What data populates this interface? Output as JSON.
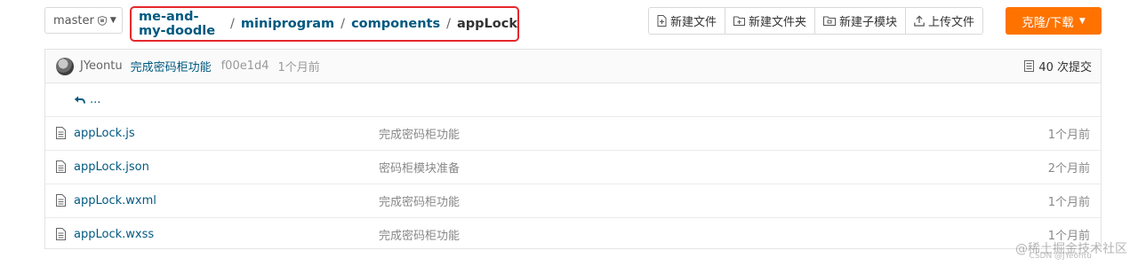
{
  "branch": {
    "name": "master"
  },
  "breadcrumb": {
    "items": [
      "me-and-my-doodle",
      "miniprogram",
      "components"
    ],
    "current": "appLock",
    "separator": "/"
  },
  "toolbar": {
    "new_file": "新建文件",
    "new_folder": "新建文件夹",
    "new_submodule": "新建子模块",
    "upload": "上传文件",
    "clone": "克隆/下载"
  },
  "commit": {
    "author": "JYeontu",
    "message": "完成密码柜功能",
    "sha": "f00e1d4",
    "time": "1个月前",
    "count": "40 次提交"
  },
  "parent_link": "...",
  "files": [
    {
      "name": "appLock.js",
      "message": "完成密码柜功能",
      "time": "1个月前"
    },
    {
      "name": "appLock.json",
      "message": "密码柜模块准备",
      "time": "2个月前"
    },
    {
      "name": "appLock.wxml",
      "message": "完成密码柜功能",
      "time": "1个月前"
    },
    {
      "name": "appLock.wxss",
      "message": "完成密码柜功能",
      "time": "1个月前"
    }
  ],
  "watermark": {
    "main": "@稀土掘金技术社区",
    "sub": "CSDN @JYeontu"
  },
  "colors": {
    "link": "#005980",
    "clone_button": "#fe7300",
    "highlight_box": "#e5282c"
  }
}
